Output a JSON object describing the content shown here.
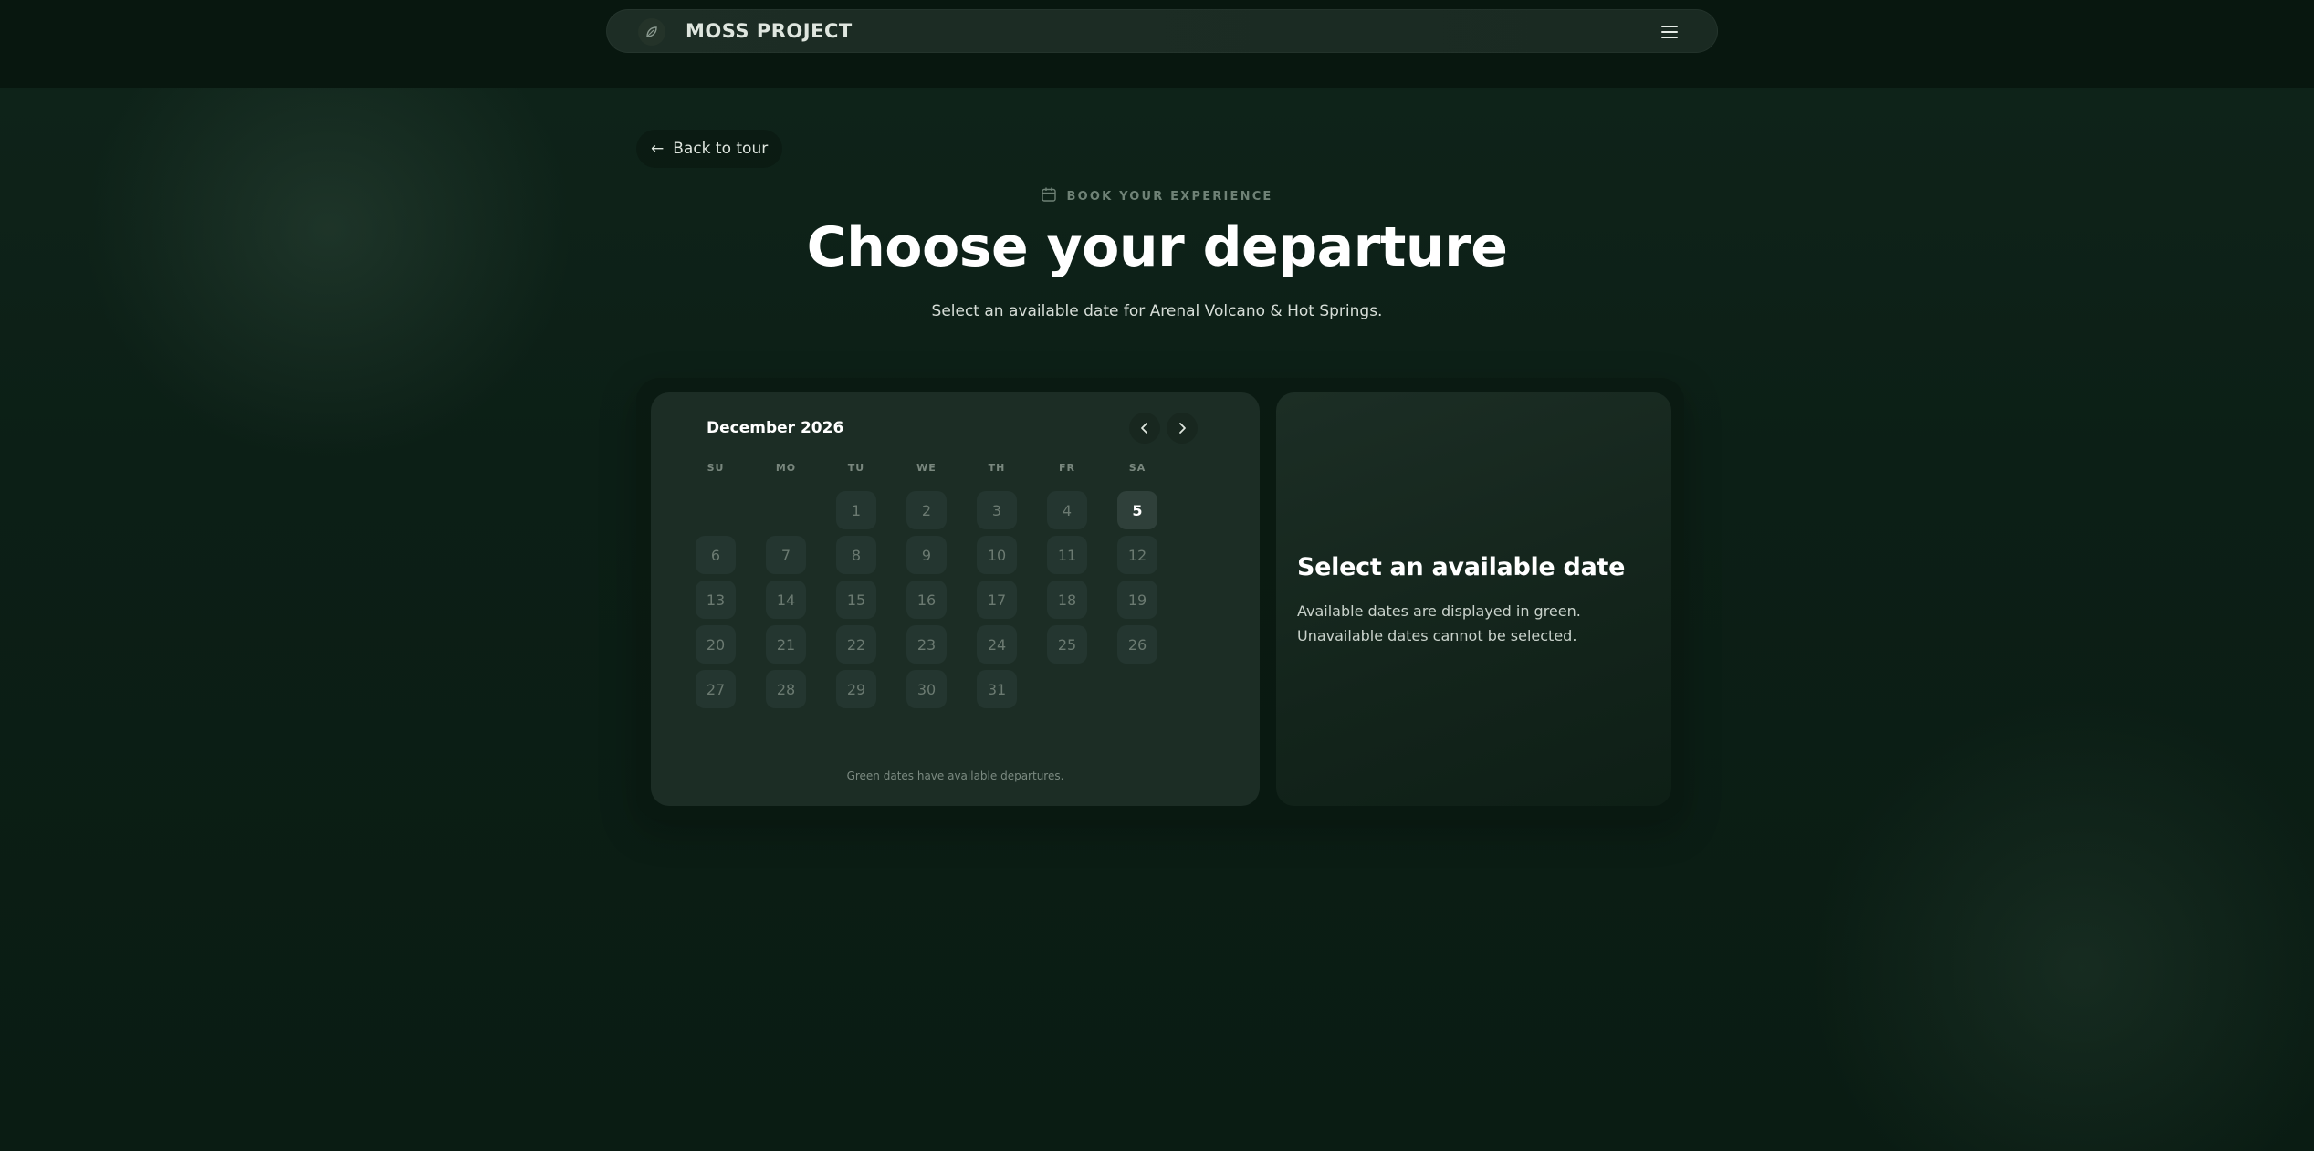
{
  "header": {
    "brand": "MOSS PROJECT",
    "logo_icon": "leaf-icon",
    "menu_icon": "hamburger-icon"
  },
  "back_link": {
    "arrow": "←",
    "label": "Back to tour"
  },
  "hero": {
    "eyebrow": "BOOK YOUR EXPERIENCE",
    "eyebrow_icon": "calendar-icon",
    "title": "Choose your departure",
    "subtitle": "Select an available date for Arenal Volcano & Hot Springs."
  },
  "calendar": {
    "month": "December 2026",
    "weekdays": [
      "SU",
      "MO",
      "TU",
      "WE",
      "TH",
      "FR",
      "SA"
    ],
    "first_weekday_index": 2,
    "days": [
      "1",
      "2",
      "3",
      "4",
      "5",
      "6",
      "7",
      "8",
      "9",
      "10",
      "11",
      "12",
      "13",
      "14",
      "15",
      "16",
      "17",
      "18",
      "19",
      "20",
      "21",
      "22",
      "23",
      "24",
      "25",
      "26",
      "27",
      "28",
      "29",
      "30",
      "31"
    ],
    "highlighted_day": "5",
    "legend": "Green dates have available departures.",
    "prev_icon": "chevron-left-icon",
    "next_icon": "chevron-right-icon"
  },
  "info": {
    "title": "Select an available date",
    "text": "Available dates are displayed in green. Unavailable dates cannot be selected."
  },
  "colors": {
    "background": "#0c1f16",
    "panel": "#1c2d25",
    "day_cell": "#243630",
    "day_text_unavailable": "#6b7a71",
    "accent_text": "#ffffff"
  }
}
